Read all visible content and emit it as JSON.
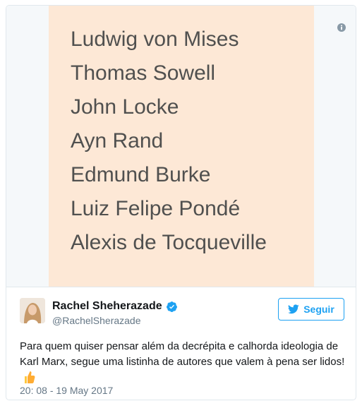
{
  "media": {
    "names": [
      "Ludwig von Mises",
      "Thomas Sowell",
      "John Locke",
      "Ayn Rand",
      "Edmund Burke",
      "Luiz Felipe Pondé",
      "Alexis de Tocqueville"
    ],
    "background_color": "#fde8d6",
    "info_icon": "info-icon"
  },
  "author": {
    "display_name": "Rachel Sheherazade",
    "handle": "@RachelSherazade",
    "verified_icon": "verified-badge-icon",
    "avatar_icon": "avatar"
  },
  "follow_button": {
    "label": "Seguir",
    "icon": "twitter-bird-icon",
    "color": "#1da1f2"
  },
  "tweet": {
    "text": "Para quem quiser pensar além da decrépita e calhorda ideologia de Karl Marx, segue uma listinha de autores que valem à pena ser lidos!",
    "emoji_icon": "thumbs-up-icon",
    "timestamp": "20: 08 - 19 May 2017"
  }
}
